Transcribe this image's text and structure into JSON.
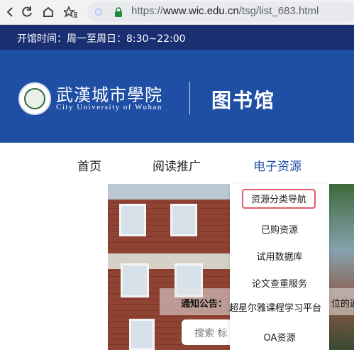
{
  "browser": {
    "url_prefix": "https://",
    "url_domain": "www.wic.edu.cn",
    "url_path": "/tsg/list_683.html",
    "icons": [
      "back-arrow-icon",
      "reload-icon",
      "home-icon",
      "star-list-icon",
      "site-info-icon",
      "lock-icon"
    ]
  },
  "hours": "开馆时间：周一至周日：8:30~22:00",
  "header": {
    "logo_cn": "武漢城市學院",
    "logo_en": "City University of Wuhan",
    "title": "图书馆"
  },
  "nav": {
    "items": [
      "首页",
      "阅读推广",
      "电子资源"
    ],
    "active": "电子资源"
  },
  "dropdown": {
    "items": [
      "资源分类导航",
      "已购资源",
      "试用数据库",
      "论文查重服务",
      "超星尔雅课程学习平台",
      "OA资源"
    ],
    "highlighted": "资源分类导航"
  },
  "notice": {
    "label": "通知公告：",
    "text": "位的通"
  },
  "search": {
    "placeholder": "搜索 标"
  },
  "colors": {
    "header_blue": "#1f4ea5",
    "strip_navy": "#1a2e72",
    "highlight_border": "#e45a6a"
  }
}
